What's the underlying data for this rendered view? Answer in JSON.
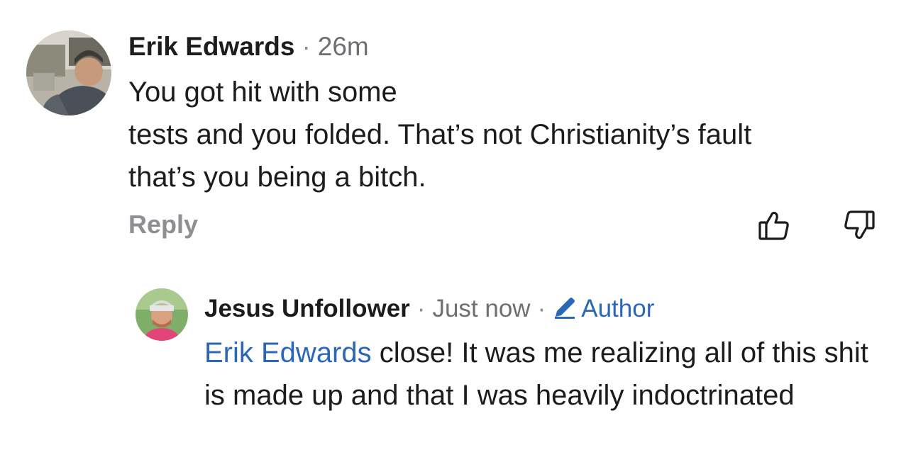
{
  "comment": {
    "author": "Erik Edwards",
    "separator": "·",
    "time": "26m",
    "lines": [
      "You got hit with some",
      "tests and you folded. That’s not Christianity’s fault",
      "that’s you being a bitch."
    ],
    "reply_label": "Reply",
    "icons": {
      "avatar": "user-avatar-photo",
      "like": "thumbs-up-icon",
      "dislike": "thumbs-down-icon"
    }
  },
  "reply": {
    "author": "Jesus Unfollower",
    "separator": "·",
    "time": "Just now",
    "separator2": "·",
    "badge": "Author",
    "mention": "Erik Edwards",
    "text": " close! It was me realizing all of this shit is made up and that I was heavily indoctrinated",
    "icons": {
      "avatar": "user-avatar-photo",
      "badge": "pencil-icon"
    }
  },
  "colors": {
    "link": "#2b67b8",
    "muted": "#8e8e93",
    "text": "#1c1c1e"
  }
}
